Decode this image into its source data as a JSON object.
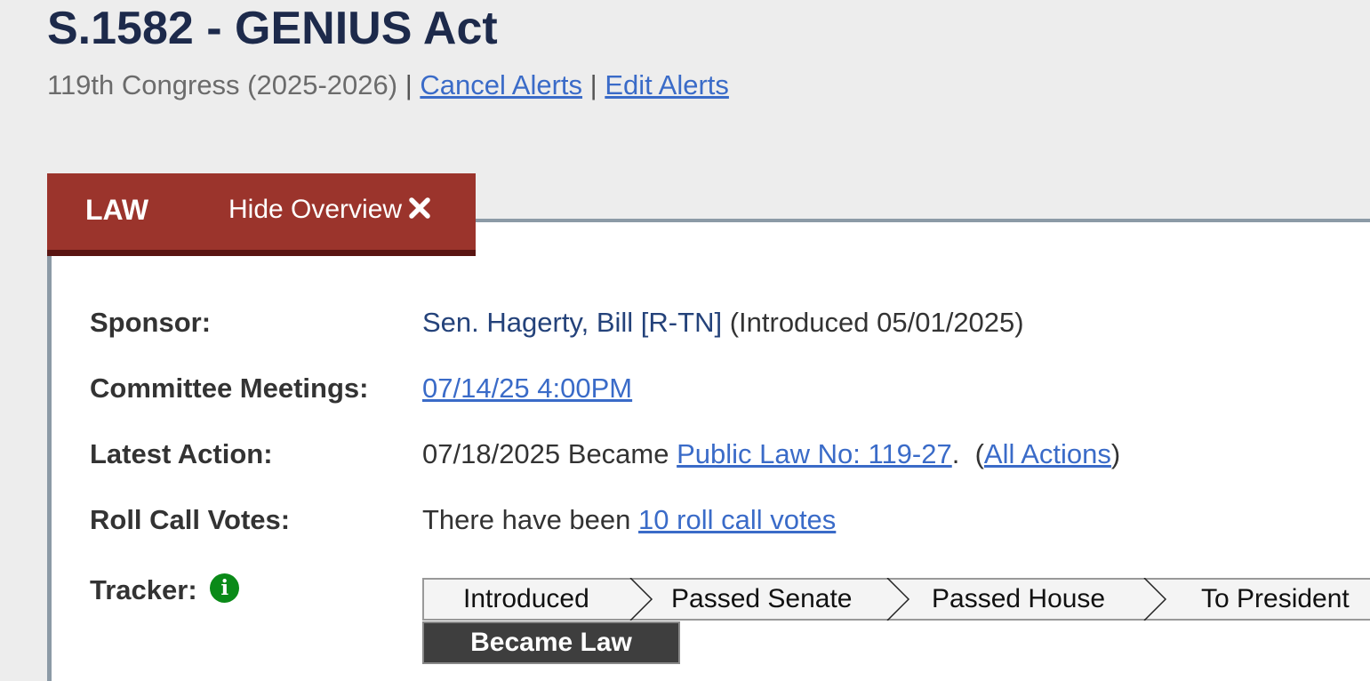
{
  "bill": {
    "title": "S.1582 - GENIUS Act",
    "congress": "119th Congress (2025-2026)",
    "separator": "|",
    "cancel_alerts": "Cancel Alerts",
    "edit_alerts": "Edit Alerts"
  },
  "tab": {
    "status": "LAW",
    "hide_overview": "Hide Overview"
  },
  "overview": {
    "sponsor": {
      "label": "Sponsor:",
      "name": "Sen. Hagerty, Bill [R-TN]",
      "introduced": "(Introduced 05/01/2025)"
    },
    "committee": {
      "label": "Committee Meetings:",
      "meeting": "07/14/25 4:00PM"
    },
    "latest_action": {
      "label": "Latest Action:",
      "text": "07/18/2025 Became",
      "law_link": "Public Law No: 119-27",
      "after": ".  (",
      "all_actions": "All Actions",
      "close": ")"
    },
    "roll_call": {
      "label": "Roll Call Votes:",
      "text": "There have been",
      "link": "10 roll call votes"
    },
    "tracker": {
      "label": "Tracker:",
      "info_icon": "i",
      "steps": [
        "Introduced",
        "Passed Senate",
        "Passed House",
        "To President"
      ],
      "current": "Became Law"
    }
  },
  "colors": {
    "title": "#1d2a4b",
    "tab_bg": "#9b342c",
    "link": "#3a6bc8",
    "info_green": "#0a8a18",
    "current_step_bg": "#3e3e3e"
  },
  "icons": {
    "close": "close-icon",
    "info": "info-icon"
  }
}
